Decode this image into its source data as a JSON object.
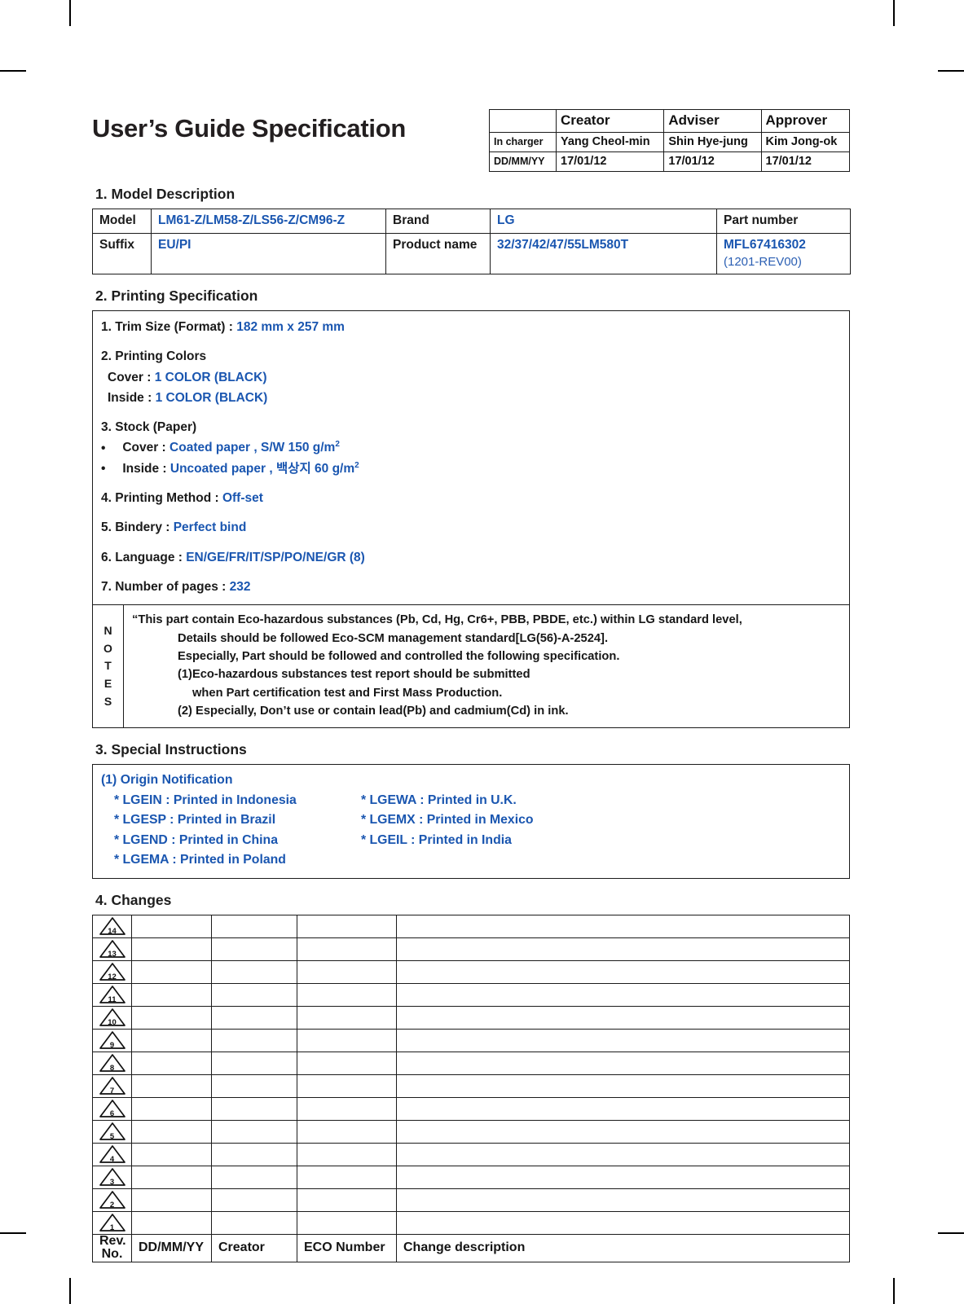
{
  "document": {
    "title": "User’s Guide Specification",
    "accent_color": "#1a56b0"
  },
  "approval_table": {
    "columns": [
      "",
      "Creator",
      "Adviser",
      "Approver"
    ],
    "rows": [
      {
        "label": "In charger",
        "values": [
          "Yang Cheol-min",
          "Shin Hye-jung",
          "Kim Jong-ok"
        ]
      },
      {
        "label": "DD/MM/YY",
        "values": [
          "17/01/12",
          "17/01/12",
          "17/01/12"
        ]
      }
    ]
  },
  "section1": {
    "heading": "1. Model Description",
    "row1": {
      "label_model": "Model",
      "value_model": "LM61-Z/LM58-Z/LS56-Z/CM96-Z",
      "label_brand": "Brand",
      "value_brand": "LG",
      "label_part": "Part number"
    },
    "row2": {
      "label_suffix": "Suffix",
      "value_suffix": "EU/PI",
      "label_product": "Product name",
      "value_product": "32/37/42/47/55LM580T",
      "value_part": "MFL67416302",
      "value_part_rev": "(1201-REV00)"
    }
  },
  "section2": {
    "heading": "2. Printing Specification",
    "trim_label": "1. Trim Size (Format) : ",
    "trim_value": "182 mm x 257 mm",
    "colors_label": "2. Printing Colors",
    "colors_cover_label": "Cover : ",
    "colors_cover_value": "1 COLOR (BLACK)",
    "colors_inside_label": "Inside : ",
    "colors_inside_value": "1 COLOR (BLACK)",
    "stock_label": "3. Stock (Paper)",
    "stock_cover_label": "Cover : ",
    "stock_cover_value": "Coated paper , S/W 150 g/m",
    "stock_cover_sup": "2",
    "stock_inside_label": "Inside : ",
    "stock_inside_value": "Uncoated paper , 백상지 60 g/m",
    "stock_inside_sup": "2",
    "method_label": "4. Printing Method : ",
    "method_value": "Off-set",
    "bindery_label": "5. Bindery  : ",
    "bindery_value": "Perfect bind",
    "language_label": "6. Language : ",
    "language_value": "EN/GE/FR/IT/SP/PO/NE/GR (8)",
    "pages_label": "7. Number of pages : ",
    "pages_value": "232",
    "notes": {
      "label_letters": [
        "N",
        "O",
        "T",
        "E",
        "S"
      ],
      "lines": [
        "“This part contain Eco-hazardous substances (Pb, Cd, Hg, Cr6+, PBB, PBDE, etc.) within LG standard level,",
        "Details should be followed Eco-SCM management standard[LG(56)-A-2524].",
        "Especially, Part should be followed and controlled the following specification.",
        "(1)Eco-hazardous substances test report should be submitted",
        "when  Part certification test and First Mass Production.",
        "(2) Especially, Don’t use or contain lead(Pb) and cadmium(Cd) in ink."
      ]
    }
  },
  "section3": {
    "heading": "3. Special Instructions",
    "origin_title": "(1) Origin Notification",
    "origin_rows": [
      {
        "left": "* LGEIN : Printed in Indonesia",
        "right": "* LGEWA : Printed in U.K."
      },
      {
        "left": "* LGESP : Printed in Brazil",
        "right": "* LGEMX : Printed in Mexico"
      },
      {
        "left": "* LGEND : Printed in China",
        "right": "* LGEIL : Printed in India"
      },
      {
        "left": "* LGEMA : Printed in Poland",
        "right": ""
      }
    ]
  },
  "section4": {
    "heading": "4. Changes",
    "rev_numbers": [
      "14",
      "13",
      "12",
      "11",
      "10",
      "9",
      "8",
      "7",
      "6",
      "5",
      "4",
      "3",
      "2",
      "1"
    ],
    "footer": {
      "rev_no_line1": "Rev.",
      "rev_no_line2": "No.",
      "date": "DD/MM/YY",
      "creator": "Creator",
      "eco": "ECO Number",
      "description": "Change description"
    }
  }
}
